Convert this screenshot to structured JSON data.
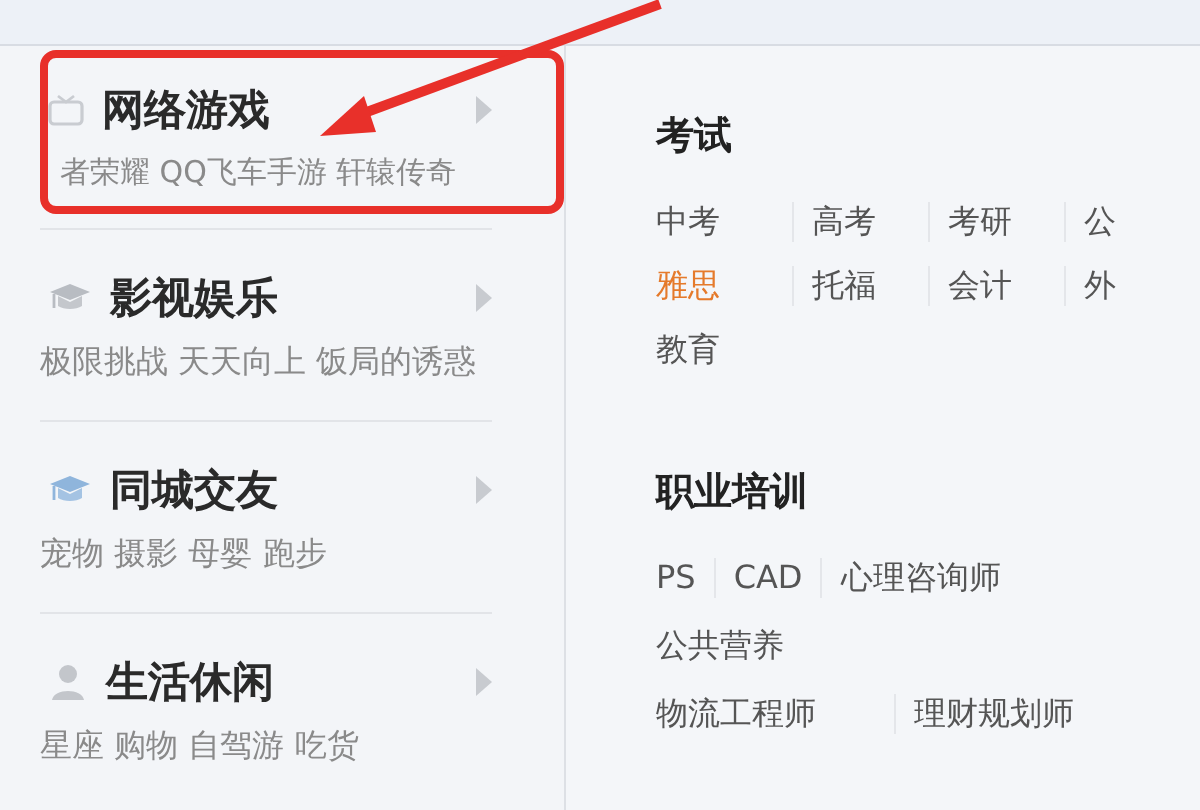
{
  "categories": [
    {
      "title": "网络游戏",
      "tags": "者荣耀 QQ飞车手游 轩辕传奇"
    },
    {
      "title": "影视娱乐",
      "tags": "极限挑战 天天向上 饭局的诱惑"
    },
    {
      "title": "同城交友",
      "tags": "宠物 摄影 母婴 跑步"
    },
    {
      "title": "生活休闲",
      "tags": "星座 购物 自驾游 吃货"
    }
  ],
  "panel": {
    "sections": [
      {
        "title": "考试",
        "links": [
          {
            "label": "中考",
            "selected": false
          },
          {
            "label": "高考",
            "selected": false
          },
          {
            "label": "考研",
            "selected": false
          },
          {
            "label": "公",
            "selected": false
          },
          {
            "label": "雅思",
            "selected": true
          },
          {
            "label": "托福",
            "selected": false
          },
          {
            "label": "会计",
            "selected": false
          },
          {
            "label": "外",
            "selected": false
          },
          {
            "label": "教育",
            "selected": false
          }
        ]
      },
      {
        "title": "职业培训",
        "links": [
          {
            "label": "PS",
            "selected": false
          },
          {
            "label": "CAD",
            "selected": false
          },
          {
            "label": "心理咨询师",
            "selected": false
          },
          {
            "label": "公共营养",
            "selected": false
          },
          {
            "label": "物流工程师",
            "selected": false
          },
          {
            "label": "理财规划师",
            "selected": false
          }
        ]
      }
    ]
  }
}
